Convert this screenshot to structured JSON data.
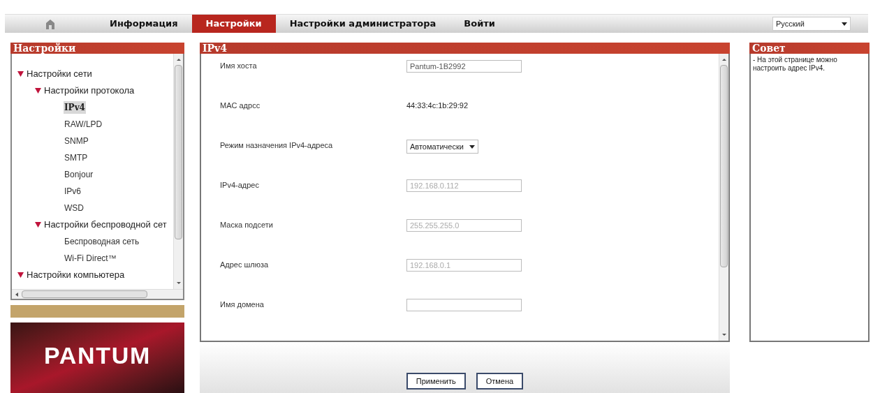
{
  "nav": {
    "tabs": [
      {
        "label": "Информация",
        "selected": false
      },
      {
        "label": "Настройки",
        "selected": true
      },
      {
        "label": "Настройки администратора",
        "selected": false
      },
      {
        "label": "Войти",
        "selected": false
      }
    ],
    "language": "Русский"
  },
  "sidebar": {
    "title": "Настройки",
    "tree": [
      {
        "label": "Настройки сети",
        "expanded": true,
        "children": [
          {
            "label": "Настройки протокола",
            "expanded": true,
            "children": [
              {
                "label": "IPv4",
                "selected": true
              },
              {
                "label": "RAW/LPD",
                "selected": false
              },
              {
                "label": "SNMP",
                "selected": false
              },
              {
                "label": "SMTP",
                "selected": false
              },
              {
                "label": "Bonjour",
                "selected": false
              },
              {
                "label": "IPv6",
                "selected": false
              },
              {
                "label": "WSD",
                "selected": false
              }
            ]
          },
          {
            "label": "Настройки беспроводной сет",
            "expanded": true,
            "children": [
              {
                "label": "Беспроводная сеть",
                "selected": false
              },
              {
                "label": "Wi-Fi Direct™",
                "selected": false
              }
            ]
          }
        ]
      },
      {
        "label": "Настройки компьютера",
        "expanded": true
      }
    ],
    "logo": "PANTUM"
  },
  "main": {
    "title": "IPv4",
    "fields": [
      {
        "kind": "input",
        "label": "Имя хоста",
        "value": "Pantum-1B2992",
        "disabled": false
      },
      {
        "kind": "text",
        "label": "MAC адрсс",
        "value": "44:33:4c:1b:29:92"
      },
      {
        "kind": "select",
        "label": "Режим назначения IPv4-адреса",
        "value": "Автоматически"
      },
      {
        "kind": "input",
        "label": "IPv4-адрес",
        "value": "192.168.0.112",
        "disabled": true
      },
      {
        "kind": "input",
        "label": "Маска подсети",
        "value": "255.255.255.0",
        "disabled": true
      },
      {
        "kind": "input",
        "label": "Адрес шлюза",
        "value": "192.168.0.1",
        "disabled": true
      },
      {
        "kind": "input",
        "label": "Имя домена"
      }
    ]
  },
  "tip": {
    "title": "Совет",
    "text": "- На этой странице можно настроить адрес IPv4."
  },
  "buttons": [
    "Применить",
    "Отмена"
  ]
}
